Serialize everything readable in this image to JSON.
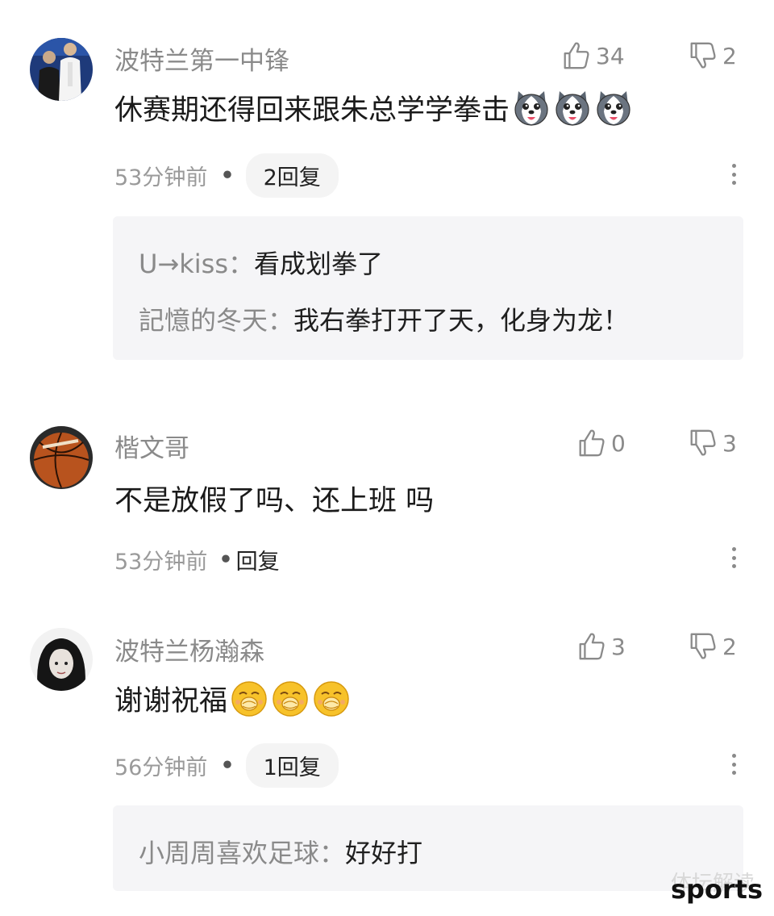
{
  "comments": [
    {
      "username": "波特兰第一中锋",
      "text": "休赛期还得回来跟朱总学学拳击",
      "emojis": [
        "husky-emoji",
        "husky-emoji",
        "husky-emoji"
      ],
      "likes": "34",
      "dislikes": "2",
      "time": "53分钟前",
      "reply_label": "2回复",
      "replies": [
        {
          "author": "U→kiss",
          "text": "看成划拳了"
        },
        {
          "author": "記憶的冬天",
          "text": "我右拳打开了天，化身为龙！"
        }
      ]
    },
    {
      "username": "楷文哥",
      "text": "不是放假了吗、还上班 吗",
      "likes": "0",
      "dislikes": "3",
      "time": "53分钟前",
      "reply_label": "回复"
    },
    {
      "username": "波特兰杨瀚森",
      "text": "谢谢祝福",
      "emojis": [
        "bless-emoji",
        "bless-emoji",
        "bless-emoji"
      ],
      "likes": "3",
      "dislikes": "2",
      "time": "56分钟前",
      "reply_label": "1回复",
      "replies": [
        {
          "author": "小周周喜欢足球",
          "text": "好好打"
        }
      ]
    }
  ],
  "separator": "：",
  "watermark": "sports",
  "watermark_faint": "体坛解读"
}
